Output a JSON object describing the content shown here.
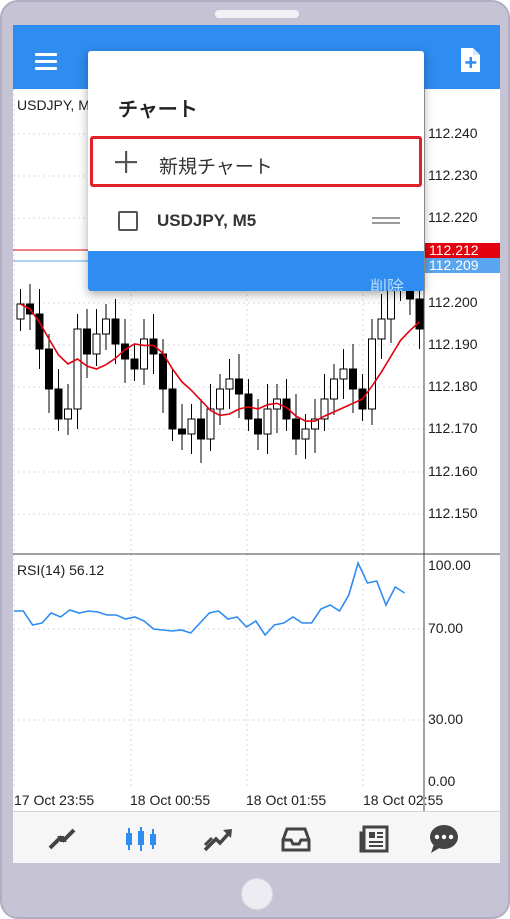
{
  "app": {
    "symbol_label": "USDJPY, M",
    "colors": {
      "accent": "#2f8cf0",
      "bid_line": "#e3000f",
      "ask_line": "#5aa5ef",
      "ma_line": "#e3000f",
      "rsi_line": "#2f8cf0"
    }
  },
  "price_axis": [
    "112.240",
    "112.230",
    "112.220",
    "112.200",
    "112.190",
    "112.180",
    "112.170",
    "112.160",
    "112.150"
  ],
  "bid_price": "112.212",
  "ask_price": "112.209",
  "rsi": {
    "title": "RSI(14) 56.12",
    "axis": [
      "100.00",
      "70.00",
      "30.00",
      "0.00"
    ]
  },
  "time_axis": [
    "17 Oct 23:55",
    "18 Oct 00:55",
    "18 Oct 01:55",
    "18 Oct 02:55"
  ],
  "popup": {
    "title": "チャート",
    "new_chart_label": "新規チャート",
    "items": [
      {
        "label": "USDJPY, M5"
      }
    ],
    "delete_label": "削除"
  },
  "bottom_nav": [
    {
      "icon": "quotes-icon"
    },
    {
      "icon": "chart-icon"
    },
    {
      "icon": "trade-icon"
    },
    {
      "icon": "history-icon"
    },
    {
      "icon": "news-icon"
    },
    {
      "icon": "chat-icon"
    }
  ]
}
